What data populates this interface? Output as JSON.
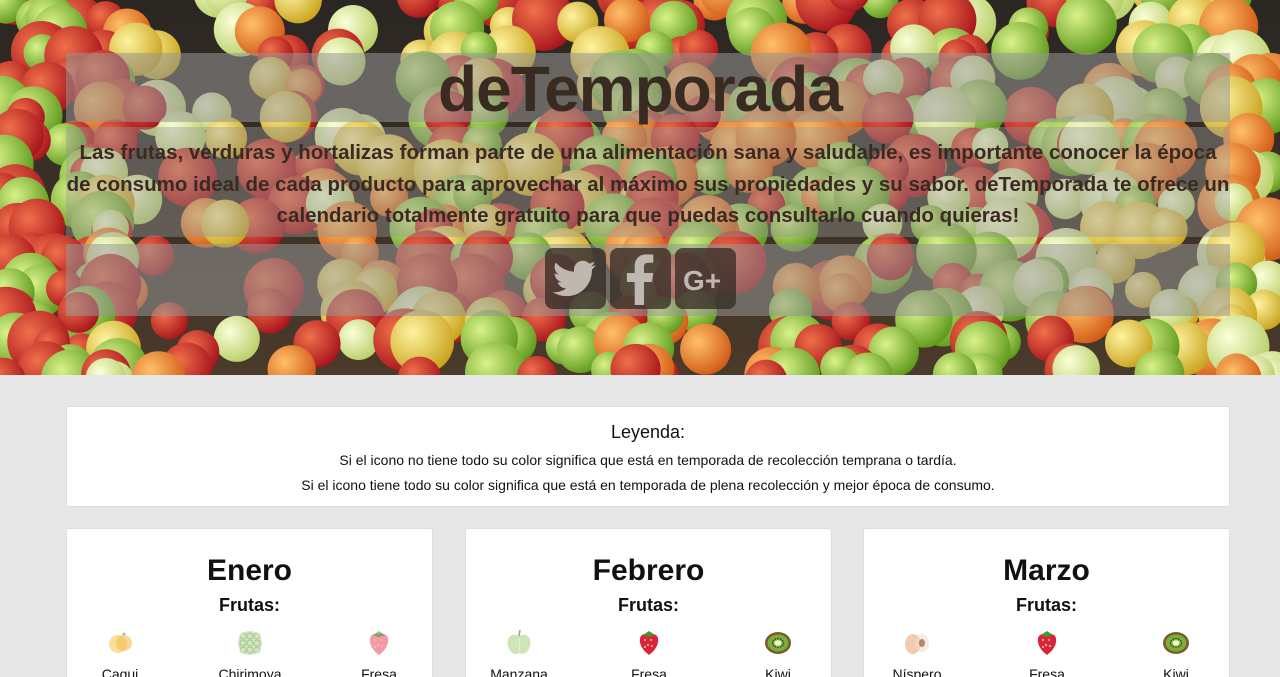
{
  "site": {
    "title": "deTemporada",
    "intro": "Las frutas, verduras y hortalizas forman parte de una alimentación sana y saludable, es importante conocer la época de consumo ideal de cada producto para aprovechar al máximo sus propiedades y su sabor. deTemporada te ofrece un calendario totalmente gratuito para que puedas consultarlo cuando quieras!",
    "social": [
      {
        "icon": "twitter-icon",
        "label": ""
      },
      {
        "icon": "facebook-icon",
        "label": ""
      },
      {
        "icon": "google-plus-icon",
        "label": ""
      }
    ]
  },
  "legend": {
    "title": "Leyenda:",
    "line1": "Si el icono no tiene todo su color significa que está en temporada de recolección temprana o tardía.",
    "line2": "Si el icono tiene todo su color significa que está en temporada de plena recolección y mejor época de consumo."
  },
  "months": [
    {
      "name": "Enero",
      "category": "Frutas:",
      "fruits": [
        {
          "name": "Caqui",
          "icon": "persimmon-icon",
          "color": "#f4c542",
          "faded": true
        },
        {
          "name": "Chirimoya",
          "icon": "cherimoya-icon",
          "color": "#a9cf8a",
          "faded": true
        },
        {
          "name": "Fresa",
          "icon": "strawberry-icon",
          "color": "#e8495a",
          "faded": true
        }
      ]
    },
    {
      "name": "Febrero",
      "category": "Frutas:",
      "fruits": [
        {
          "name": "Manzana",
          "icon": "apple-icon",
          "color": "#a6d27b",
          "faded": true
        },
        {
          "name": "Fresa",
          "icon": "strawberry-icon",
          "color": "#d9243a",
          "faded": false
        },
        {
          "name": "Kiwi",
          "icon": "kiwi-icon",
          "color": "#7cae3a",
          "faded": false
        }
      ]
    },
    {
      "name": "Marzo",
      "category": "Frutas:",
      "fruits": [
        {
          "name": "Níspero",
          "icon": "loquat-icon",
          "color": "#e9a36b",
          "faded": true
        },
        {
          "name": "Fresa",
          "icon": "strawberry-icon",
          "color": "#d9243a",
          "faded": false
        },
        {
          "name": "Kiwi",
          "icon": "kiwi-icon",
          "color": "#7cae3a",
          "faded": false
        }
      ]
    }
  ]
}
